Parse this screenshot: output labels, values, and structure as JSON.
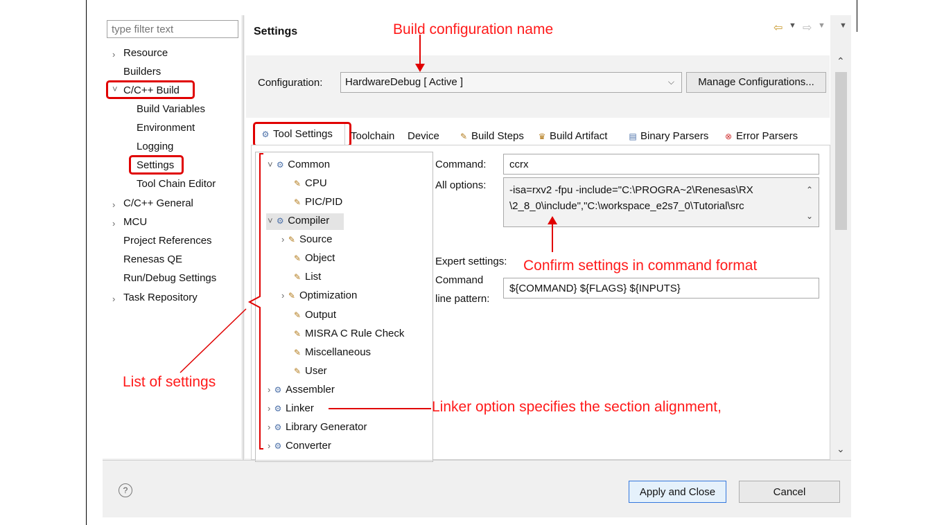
{
  "filter": {
    "placeholder": "type filter text"
  },
  "left_tree": [
    {
      "label": "Resource",
      "expander": "›"
    },
    {
      "label": "Builders",
      "expander": ""
    },
    {
      "label": "C/C++ Build",
      "expander": "˅"
    },
    {
      "label": "Build Variables",
      "expander": ""
    },
    {
      "label": "Environment",
      "expander": ""
    },
    {
      "label": "Logging",
      "expander": ""
    },
    {
      "label": "Settings",
      "expander": ""
    },
    {
      "label": "Tool Chain Editor",
      "expander": ""
    },
    {
      "label": "C/C++ General",
      "expander": "›"
    },
    {
      "label": "MCU",
      "expander": "›"
    },
    {
      "label": "Project References",
      "expander": ""
    },
    {
      "label": "Renesas QE",
      "expander": ""
    },
    {
      "label": "Run/Debug Settings",
      "expander": ""
    },
    {
      "label": "Task Repository",
      "expander": "›"
    }
  ],
  "header": {
    "title": "Settings"
  },
  "config": {
    "label": "Configuration:",
    "value": "HardwareDebug  [ Active ]",
    "manage_button": "Manage Configurations..."
  },
  "tabs": [
    {
      "label": "Tool Settings"
    },
    {
      "label": "Toolchain"
    },
    {
      "label": "Device"
    },
    {
      "label": "Build Steps"
    },
    {
      "label": "Build Artifact"
    },
    {
      "label": "Binary Parsers"
    },
    {
      "label": "Error Parsers"
    }
  ],
  "tool_tree": [
    {
      "label": "Common"
    },
    {
      "label": "CPU"
    },
    {
      "label": "PIC/PID"
    },
    {
      "label": "Compiler"
    },
    {
      "label": "Source"
    },
    {
      "label": "Object"
    },
    {
      "label": "List"
    },
    {
      "label": "Optimization"
    },
    {
      "label": "Output"
    },
    {
      "label": "MISRA C Rule Check"
    },
    {
      "label": "Miscellaneous"
    },
    {
      "label": "User"
    },
    {
      "label": "Assembler"
    },
    {
      "label": "Linker"
    },
    {
      "label": "Library Generator"
    },
    {
      "label": "Converter"
    }
  ],
  "form": {
    "command_label": "Command:",
    "command_value": "ccrx",
    "all_options_label": "All options:",
    "all_options_line1": "-isa=rxv2 -fpu -include=\"C:\\PROGRA~2\\Renesas\\RX",
    "all_options_line2": "\\2_8_0\\include\",\"C:\\workspace_e2s7_0\\Tutorial\\src",
    "expert_label": "Expert settings:",
    "pattern_label_1": "Command",
    "pattern_label_2": "line pattern:",
    "pattern_value": "${COMMAND} ${FLAGS} ${INPUTS}"
  },
  "footer": {
    "apply_close": "Apply and Close",
    "cancel": "Cancel",
    "help_icon": "?"
  },
  "annotations": {
    "build_config": "Build configuration name",
    "confirm": "Confirm settings in command format",
    "list": "List of settings",
    "linker": "Linker option specifies the section alignment,"
  },
  "colors": {
    "annotation": "#ff0000",
    "highlight": "#e00000"
  }
}
